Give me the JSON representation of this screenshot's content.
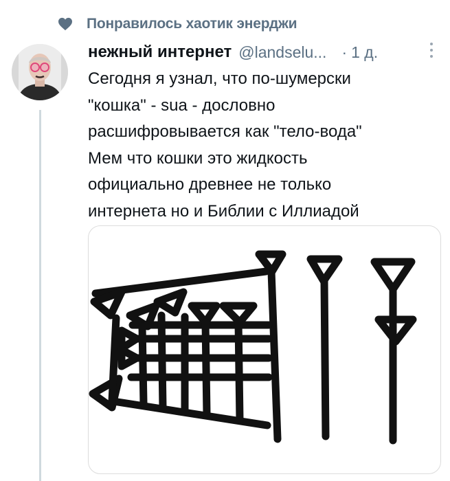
{
  "liked": {
    "icon": "heart-icon",
    "text": "Понравилось хаотик энерджи"
  },
  "tweet": {
    "author_name": "нежный интернет",
    "handle": "@landselu...",
    "separator": "·",
    "time": "1 д.",
    "lines": [
      "Сегодня я узнал, что по-шумерски",
      "\"кошка\" - sua - дословно",
      "расшифровывается как \"тело-вода\"",
      "Мем что кошки это жидкость",
      "официально древнее не только",
      "интернета но и Библии с Иллиадой"
    ],
    "media": {
      "icon": "cuneiform-sign-icon"
    }
  },
  "colors": {
    "muted": "#5b7083",
    "text": "#0f1419",
    "thread": "#cfd9de"
  }
}
